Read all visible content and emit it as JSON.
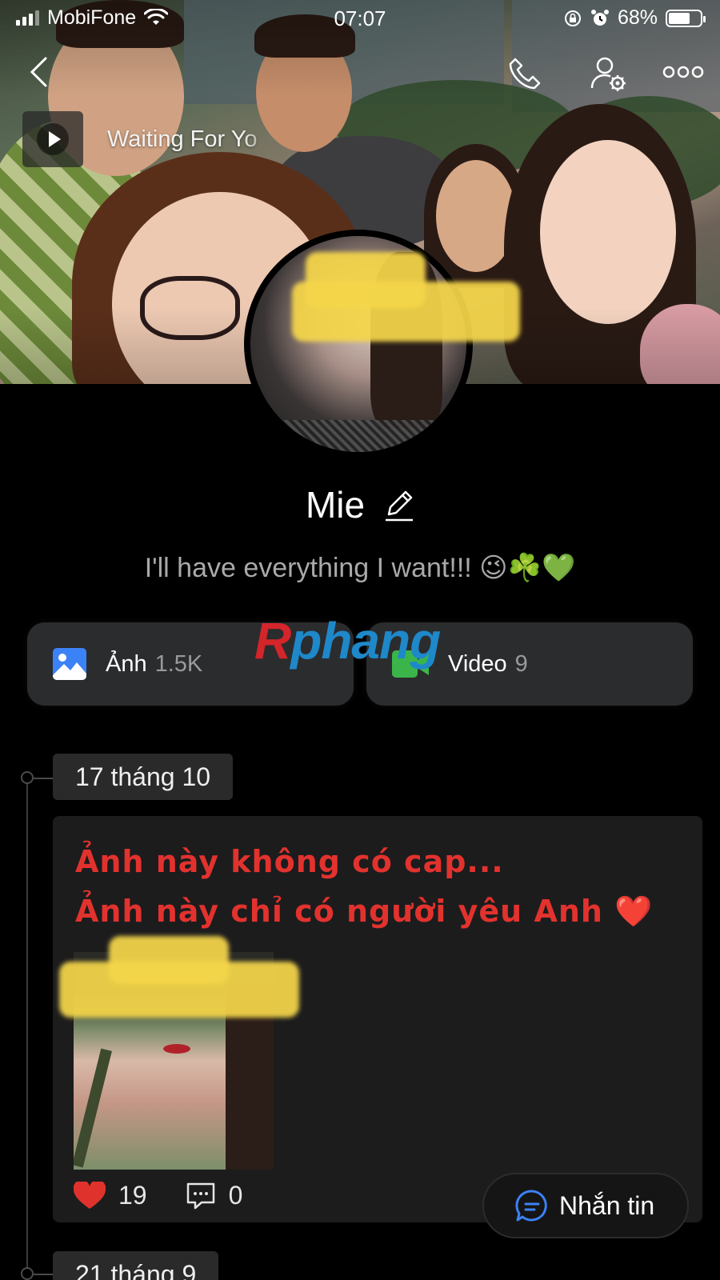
{
  "status_bar": {
    "carrier": "MobiFone",
    "time": "07:07",
    "battery": "68%",
    "battery_level": 0.68
  },
  "music": {
    "title": "Waiting For Yo"
  },
  "profile": {
    "name": "Mie",
    "bio": "I'll have everything I want!!!",
    "bio_emojis": "😉☘️💚"
  },
  "media": {
    "photos_label": "Ảnh",
    "photos_count": "1.5K",
    "videos_label": "Video",
    "videos_count": "9"
  },
  "watermark": {
    "initial": "R",
    "rest": "phang"
  },
  "timeline": [
    {
      "date": "17 tháng 10",
      "caption_line1": "Ảnh này không có cap...",
      "caption_line2": "Ảnh này chỉ có người yêu Anh",
      "caption_emoji": "❤️",
      "likes": "19",
      "comments": "0"
    },
    {
      "date": "21 tháng 9"
    }
  ],
  "chat_button": {
    "label": "Nhắn tin"
  },
  "colors": {
    "accent_blue": "#3b82f6",
    "video_green": "#3bb54a",
    "caption_red": "#e2322e",
    "like_red": "#e0322c"
  },
  "icons": [
    "back-icon",
    "phone-icon",
    "user-settings-icon",
    "more-icon",
    "play-icon",
    "edit-icon",
    "image-icon",
    "video-camera-icon",
    "heart-icon",
    "comment-icon",
    "chat-icon"
  ]
}
